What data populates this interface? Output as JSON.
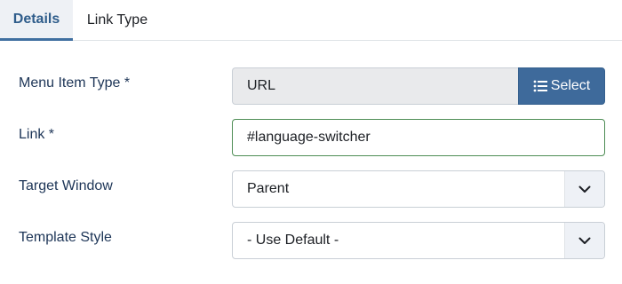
{
  "tabs": [
    {
      "label": "Details",
      "active": true
    },
    {
      "label": "Link Type",
      "active": false
    }
  ],
  "form": {
    "menu_item_type": {
      "label": "Menu Item Type *",
      "value": "URL",
      "button_label": "Select",
      "button_icon": "list-icon"
    },
    "link": {
      "label": "Link *",
      "value": "#language-switcher"
    },
    "target_window": {
      "label": "Target Window",
      "value": "Parent",
      "icon": "chevron-down-icon"
    },
    "template_style": {
      "label": "Template Style",
      "value": "- Use Default -",
      "icon": "chevron-down-icon"
    }
  },
  "colors": {
    "accent": "#3e6a9b",
    "active_tab_text": "#2f5d8b",
    "valid_border": "#4e8d55",
    "readonly_bg": "#e9eaec"
  }
}
